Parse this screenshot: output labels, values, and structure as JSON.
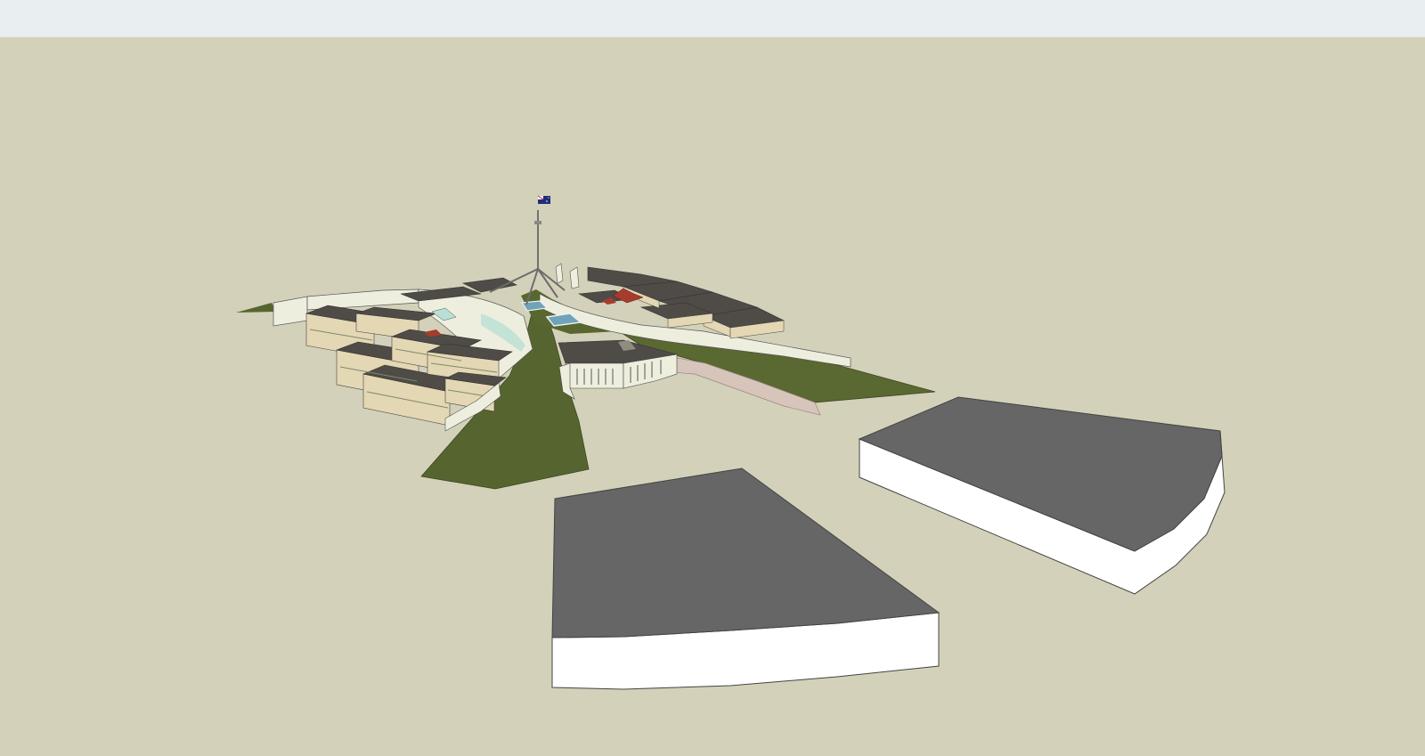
{
  "app": {
    "kind": "3d-modeling-viewport",
    "toolbar_color": "#e9eff0",
    "ground_color": "#d3d1b9"
  },
  "scene": {
    "subject": "parliament-house-model",
    "colors": {
      "lawn": "#56652f",
      "roof": "#4f4b47",
      "facade": "#e4d7b4",
      "wall": "#eeeedf",
      "glass": "#b9e0d4",
      "proxy_top": "#666666",
      "proxy_side": "#ffffff",
      "water": "#6fa3b8",
      "red_roof": "#a53c2c",
      "flag_blue": "#1f2d7a",
      "flag_red": "#c2202f"
    },
    "objects": [
      {
        "name": "flagpole",
        "icon": "flag-icon"
      },
      {
        "name": "left-wing"
      },
      {
        "name": "right-wing"
      },
      {
        "name": "central-lawn"
      },
      {
        "name": "forecourt-building"
      },
      {
        "name": "proxy-block-front"
      },
      {
        "name": "proxy-block-right"
      }
    ]
  }
}
